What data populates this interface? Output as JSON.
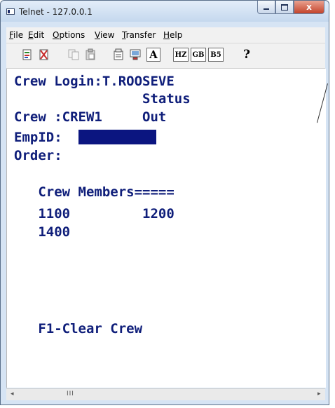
{
  "window": {
    "title": "Telnet - 127.0.0.1",
    "caption_buttons": [
      "minimize-icon",
      "maximize-icon",
      "close-icon"
    ],
    "close_glyph": "x"
  },
  "menubar": {
    "items": [
      {
        "label": "File",
        "mnemonic": "F",
        "rest": "ile"
      },
      {
        "label": "Edit",
        "mnemonic": "E",
        "rest": "dit"
      },
      {
        "label": "Options",
        "mnemonic": "O",
        "rest": "ptions"
      },
      {
        "label": "View",
        "mnemonic": "V",
        "rest": "iew"
      },
      {
        "label": "Transfer",
        "mnemonic": "T",
        "rest": "ransfer"
      },
      {
        "label": "Help",
        "mnemonic": "H",
        "rest": "elp"
      }
    ]
  },
  "toolbar": {
    "buttons": [
      {
        "icon": "connect-icon"
      },
      {
        "icon": "disconnect-icon"
      },
      {
        "icon": "copy-icon"
      },
      {
        "icon": "paste-icon"
      },
      {
        "icon": "properties-icon"
      },
      {
        "icon": "display-icon"
      },
      {
        "icon": "font-icon",
        "label": "A"
      },
      {
        "icon": "hz-encoding-icon",
        "label": "HZ"
      },
      {
        "icon": "gb-encoding-icon",
        "label": "GB"
      },
      {
        "icon": "b5-encoding-icon",
        "label": "B5"
      },
      {
        "icon": "help-icon",
        "label": "?"
      }
    ]
  },
  "terminal": {
    "lines": [
      "Crew Login:T.ROOSEVE",
      "                Status",
      "Crew :CREW1     Out",
      "EmpID:",
      "Order:",
      "",
      "   Crew Members=====",
      "   1100         1200",
      "   1400",
      "",
      "",
      "",
      "",
      "",
      "   F1-Clear Crew"
    ],
    "colors": {
      "text": "#0f1e7a",
      "cursor_block": "#0b1580",
      "background": "#ffffff"
    }
  },
  "scrollbar": {
    "left_arrow": "◂",
    "right_arrow": "▸",
    "grip": "III"
  }
}
